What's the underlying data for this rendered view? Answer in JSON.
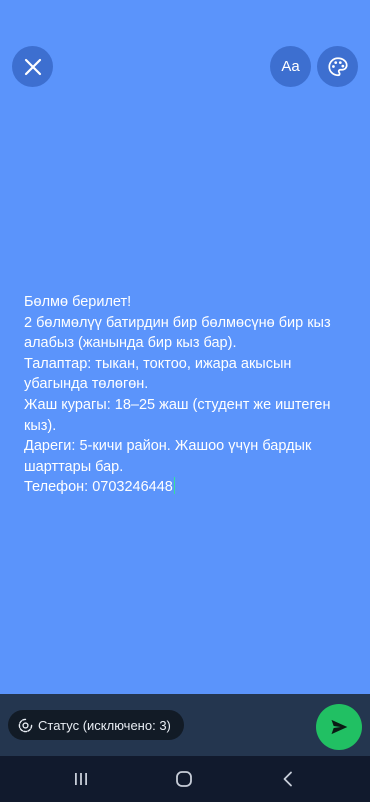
{
  "header": {
    "close_icon": "close-icon",
    "font_button_label": "Aa",
    "palette_icon": "palette-icon"
  },
  "status": {
    "text": "Бөлмө берилет!\n2 бөлмөлүү батирдин бир бөлмөсүнө бир кыз алабыз (жанында бир кыз бар).\nТалаптар: тыкан, токтоо, ижара акысын убагында төлөгөн.\nЖаш курагы: 18–25 жаш (студент же иштеген кыз).\nДареги: 5-кичи район. Жашоо үчүн бардык шарттары бар.\nТелефон: 0703246448",
    "background_color": "#5b94fb",
    "text_color": "#ffffff",
    "cursor_color": "#35e19b"
  },
  "footer": {
    "privacy_label": "Статус (исключено: 3)",
    "privacy_icon": "privacy-icon",
    "send_icon": "send-icon",
    "send_color": "#21c063"
  },
  "navigation": {
    "recents_icon": "recents-icon",
    "home_icon": "home-icon",
    "back_icon": "back-icon"
  }
}
